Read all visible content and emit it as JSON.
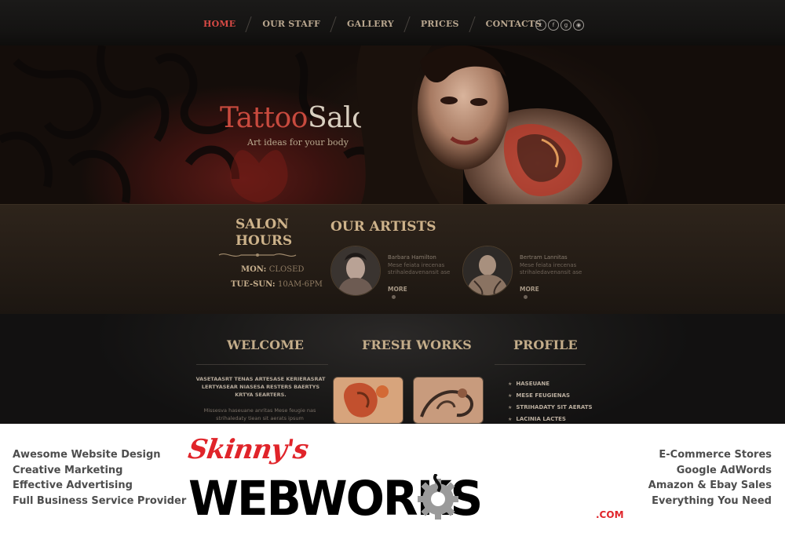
{
  "nav": {
    "items": [
      {
        "label": "HOME",
        "active": true
      },
      {
        "label": "OUR STAFF",
        "active": false
      },
      {
        "label": "GALLERY",
        "active": false
      },
      {
        "label": "PRICES",
        "active": false
      },
      {
        "label": "CONTACTS",
        "active": false
      }
    ],
    "social_icons": [
      "twitter-icon",
      "facebook-icon",
      "google-plus-icon",
      "rss-icon"
    ]
  },
  "hero": {
    "title_part1": "Tattoo",
    "title_part2": "Salon",
    "subtitle": "Art ideas for your body"
  },
  "salon_hours": {
    "title_line1": "SALON",
    "title_line2": "HOURS",
    "rows": [
      {
        "day": "MON:",
        "value": "CLOSED"
      },
      {
        "day": "TUE-SUN:",
        "value": "10AM-6PM"
      }
    ]
  },
  "artists": {
    "title": "OUR ARTISTS",
    "items": [
      {
        "name": "Barbara Hamilton",
        "desc": "Mese feiata irecenas strihaledavenansit ase",
        "more": "MORE"
      },
      {
        "name": "Bertram Lannitas",
        "desc": "Mese feiata irecenas strihaledavenansit ase",
        "more": "MORE"
      }
    ]
  },
  "welcome": {
    "title": "WELCOME",
    "bold_text": "VASETAASRT TENAS ARTESASE KERIERASRAT LERTYASEAR NIASESA RESTERS BAERTYS KRTYA SEARTERS.",
    "text": "Missesva haseuane anritas Mese feugie nas strihaledaty tiean sit aerats ipsum"
  },
  "fresh_works": {
    "title": "FRESH WORKS"
  },
  "profile": {
    "title": "PROFILE",
    "items": [
      "HASEUANE",
      "MESE FEUGIENAS",
      "STRIHADATY SIT AERATS",
      "LACINIA LACTES"
    ]
  },
  "banner": {
    "left_lines": [
      "Awesome Website Design",
      "Creative Marketing",
      "Effective Advertising",
      "Full Business Service Provider"
    ],
    "right_lines": [
      "E-Commerce Stores",
      "Google AdWords",
      "Amazon & Ebay Sales",
      "Everything You Need"
    ],
    "logo_script": "Skinny's",
    "logo_main": "WEBWORKS",
    "logo_domain": ".COM"
  },
  "colors": {
    "accent_red": "#d84a45",
    "nav_text": "#b9a78f",
    "heading_gold": "#cdb28a",
    "logo_red": "#e0242a"
  }
}
